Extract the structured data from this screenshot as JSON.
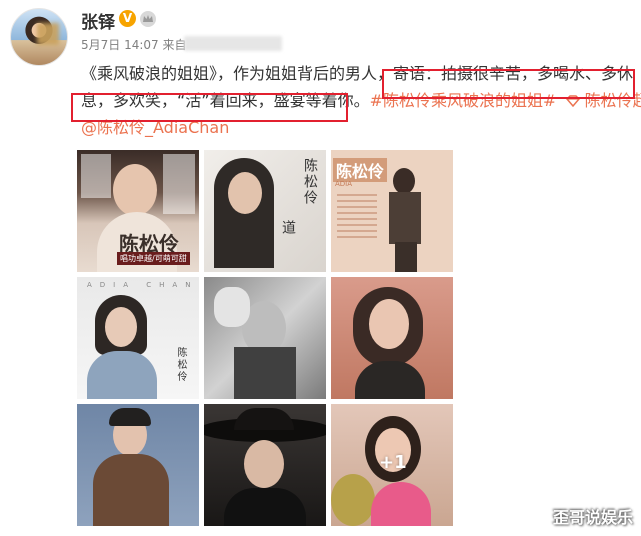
{
  "user": {
    "name": "张铎",
    "verified_badge": "V",
    "avatar_icon": "avatar"
  },
  "meta": {
    "date": "5月7日 14:07",
    "source_prefix": "来自"
  },
  "post": {
    "line1_a": "《乘风破浪的姐姐》，作为姐姐背后的男人，",
    "line1_b": "寄语：拍摄很辛苦，多喝水、多休",
    "line2_a": "息，多欢笑，“活”着回来，盛宴等着你。",
    "line2_tag": "#陈松伶乘风破浪的姐姐#",
    "line2_super": "陈松伶超话",
    "line3_mention": "@陈松伶_AdiaChan"
  },
  "images": {
    "tile1_name": "陈松伶",
    "tile1_sub": "唱功卓越/可萌可甜",
    "tile2_name": "陈松伶",
    "tile2_sub": "道",
    "tile3_name": "陈松伶",
    "tile3_sub": "ADIA",
    "tile4_top": "ADIA CHAN",
    "tile4_name": "陈松伶",
    "more_count": "+1"
  },
  "watermark": {
    "text": "歪哥说娱乐"
  },
  "colors": {
    "link": "#eb7350",
    "highlight_box": "#e2202f",
    "verified": "#f7a400"
  }
}
